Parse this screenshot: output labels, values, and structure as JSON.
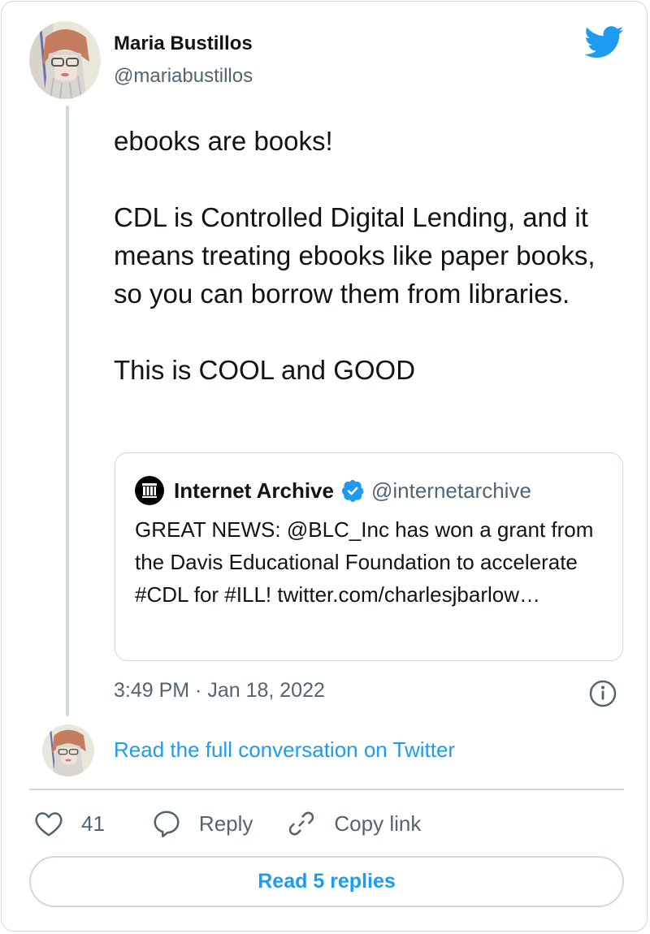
{
  "author": {
    "name": "Maria Bustillos",
    "handle": "@mariabustillos"
  },
  "tweet": {
    "text": "ebooks are books!\n\nCDL is Controlled Digital Lending, and it means treating ebooks like paper books, so you can borrow them from libraries.\n\nThis is COOL and GOOD",
    "timestamp": "3:49 PM · Jan 18, 2022"
  },
  "quoted_tweet": {
    "name": "Internet Archive",
    "handle": "@internetarchive",
    "verified": true,
    "text": "GREAT NEWS: @BLC_Inc has won a grant from the Davis Educational Foundation to accelerate #CDL for #ILL! twitter.com/charlesjbarlow…"
  },
  "links": {
    "read_conversation": "Read the full conversation on Twitter"
  },
  "actions": {
    "like_count": "41",
    "reply_label": "Reply",
    "copy_link_label": "Copy link"
  },
  "read_replies_label": "Read 5 replies",
  "icons": {
    "brand": "twitter-bird-icon",
    "verified": "verified-badge-icon",
    "info": "info-icon",
    "like": "heart-icon",
    "reply": "speech-bubble-icon",
    "copy": "link-icon"
  },
  "colors": {
    "accent": "#1d9bf0",
    "text_primary": "#0f1419",
    "text_secondary": "#536471",
    "border": "#cfd9de"
  }
}
